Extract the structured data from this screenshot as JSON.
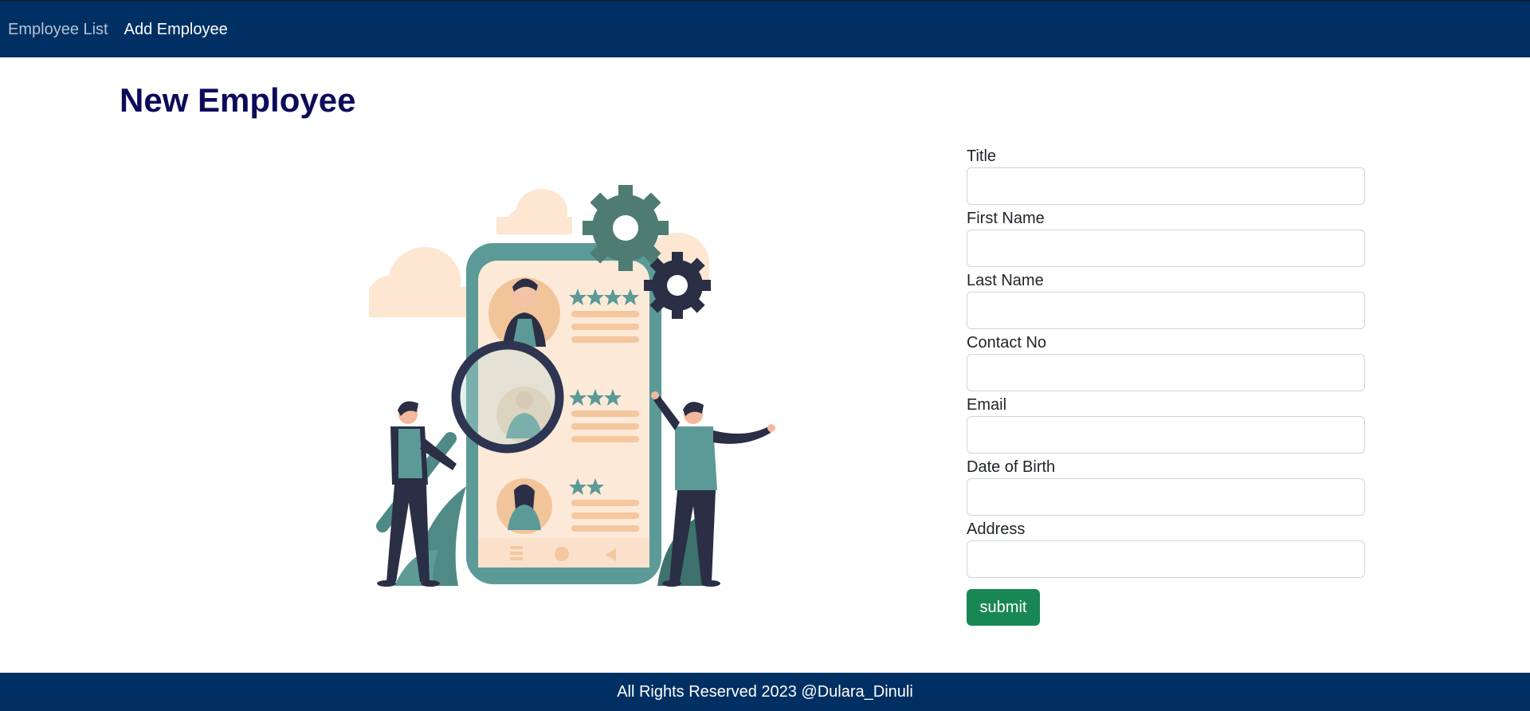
{
  "nav": {
    "employee_list": "Employee List",
    "add_employee": "Add Employee"
  },
  "page": {
    "title": "New Employee"
  },
  "form": {
    "title_label": "Title",
    "first_name_label": "First Name",
    "last_name_label": "Last Name",
    "contact_label": "Contact No",
    "email_label": "Email",
    "dob_label": "Date of Birth",
    "address_label": "Address",
    "title_value": "",
    "first_name_value": "",
    "last_name_value": "",
    "contact_value": "",
    "email_value": "",
    "dob_value": "",
    "address_value": "",
    "submit_label": "submit"
  },
  "footer": {
    "text": "All Rights Reserved 2023 @Dulara_Dinuli"
  },
  "colors": {
    "navbar": "#003063",
    "title": "#0c0b5a",
    "submit": "#198754"
  },
  "illustration": {
    "icon": "employee-review-illustration"
  }
}
